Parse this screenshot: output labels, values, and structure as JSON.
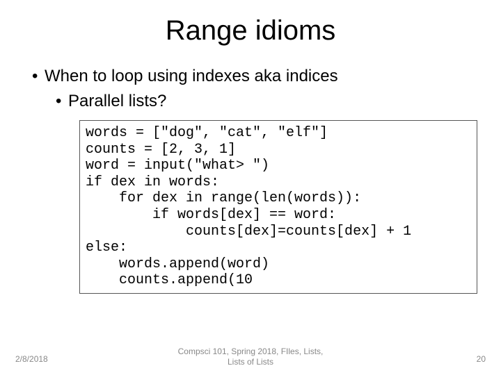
{
  "title": "Range idioms",
  "bullets": {
    "b1": "When to loop using indexes aka indices",
    "b2": "Parallel lists?"
  },
  "code": "words = [\"dog\", \"cat\", \"elf\"]\ncounts = [2, 3, 1]\nword = input(\"what> \")\nif dex in words:\n    for dex in range(len(words)):\n        if words[dex] == word:\n            counts[dex]=counts[dex] + 1\nelse:\n    words.append(word)\n    counts.append(10",
  "footer": {
    "date": "2/8/2018",
    "center_line1": "Compsci 101, Spring 2018, FIles, Lists,",
    "center_line2": "Lists of Lists",
    "page": "20"
  }
}
